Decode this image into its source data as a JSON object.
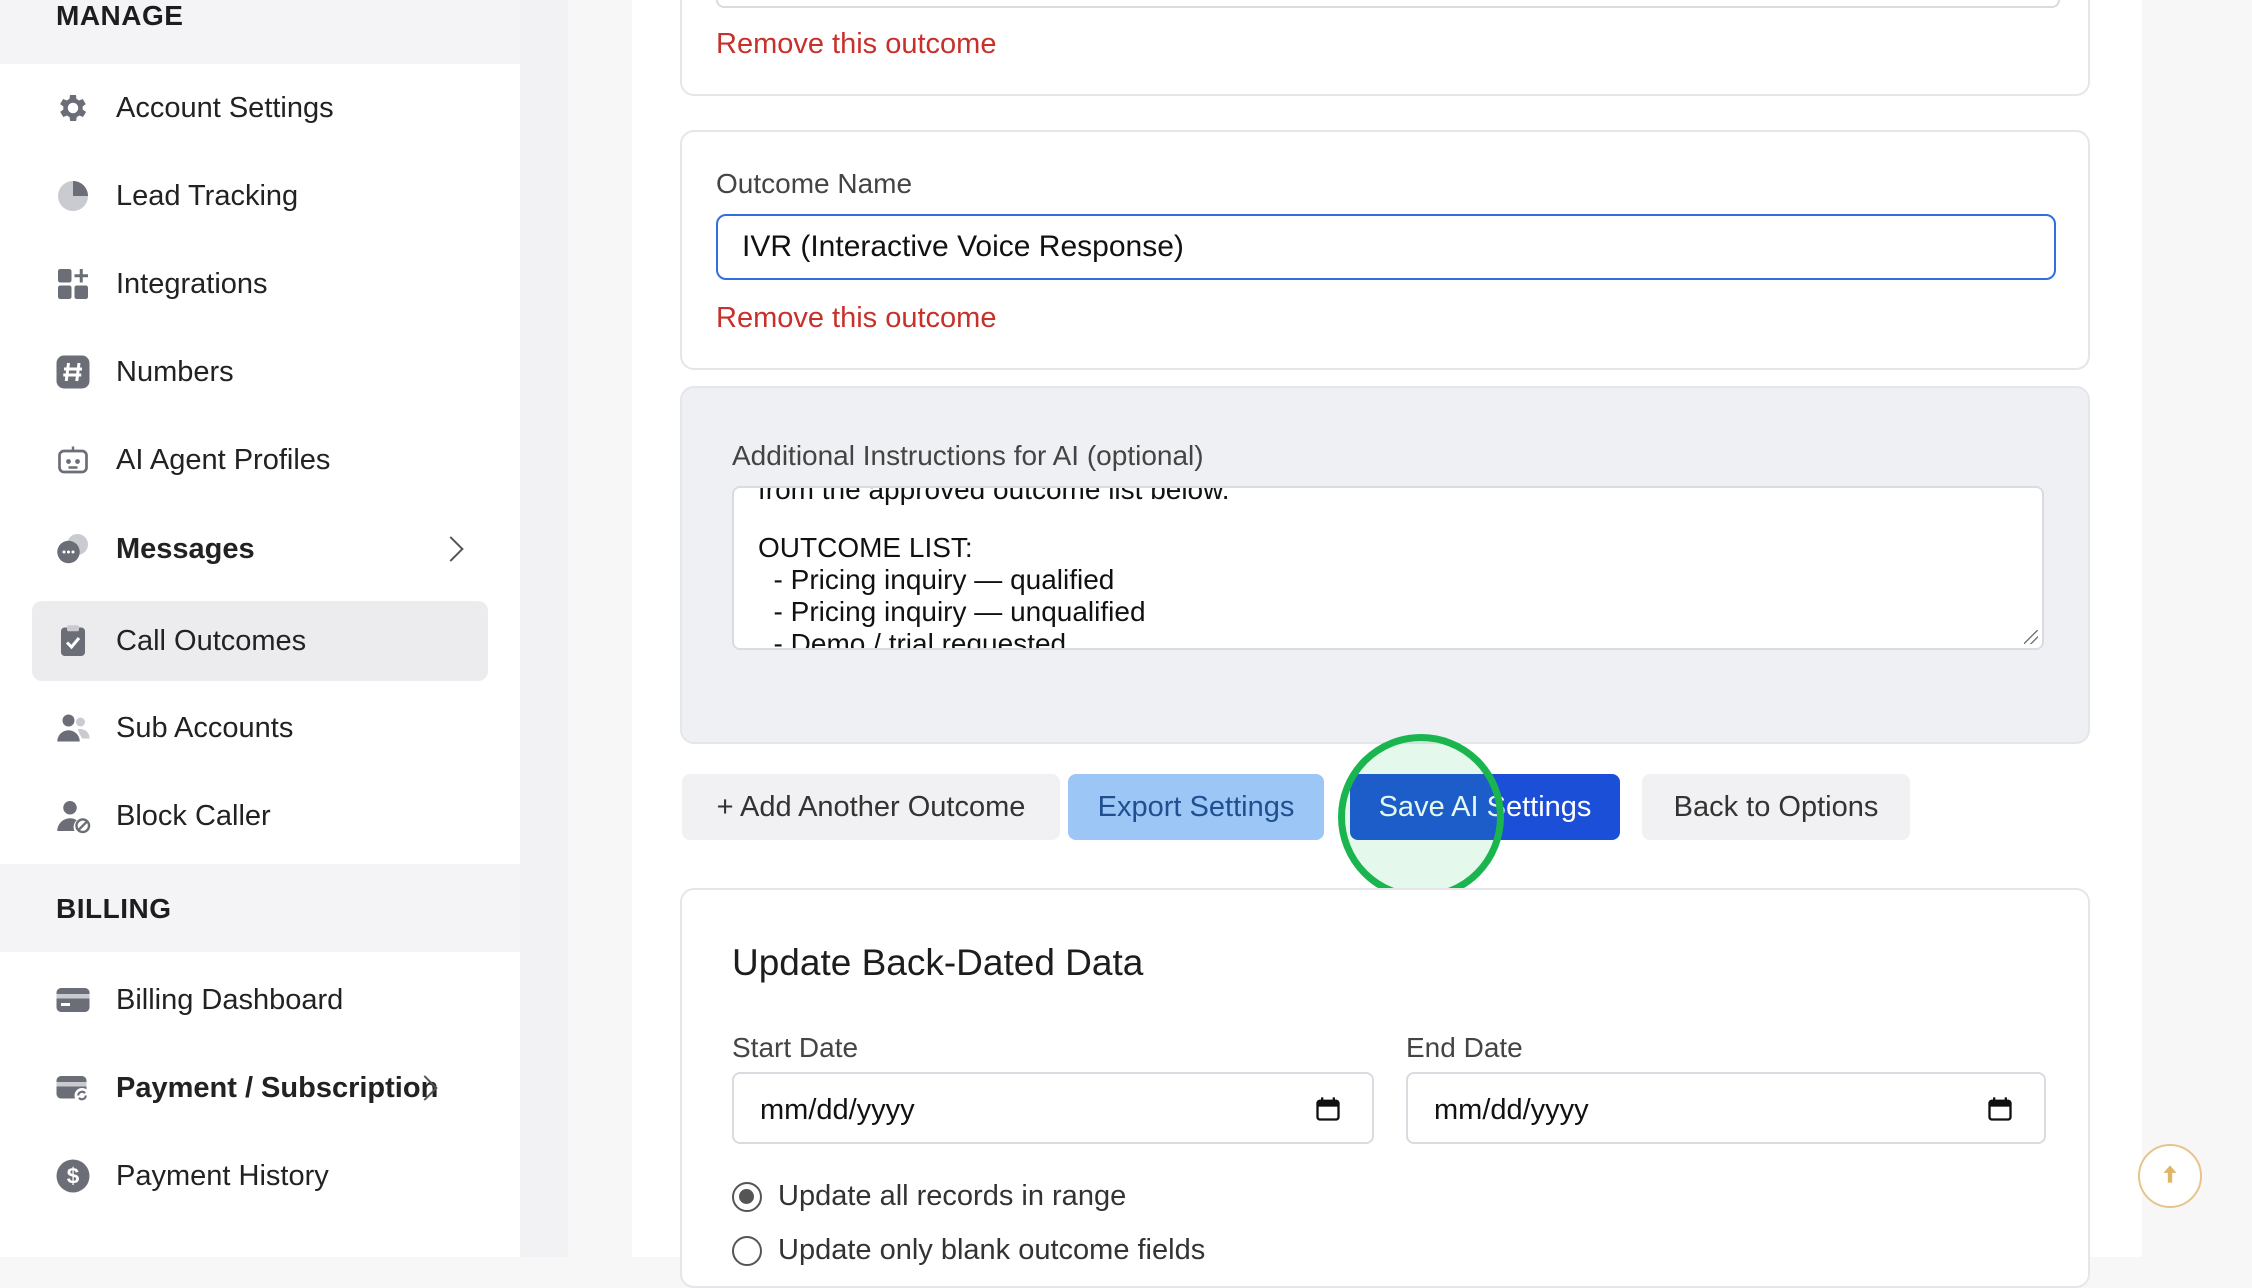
{
  "sidebar": {
    "manage_header": "MANAGE",
    "billing_header": "BILLING",
    "manage_items": [
      {
        "label": "Account Settings",
        "icon": "gear-icon"
      },
      {
        "label": "Lead Tracking",
        "icon": "pie-chart-icon"
      },
      {
        "label": "Integrations",
        "icon": "grid-plus-icon"
      },
      {
        "label": "Numbers",
        "icon": "hashtag-icon"
      },
      {
        "label": "AI Agent Profiles",
        "icon": "robot-icon"
      },
      {
        "label": "Messages",
        "icon": "chat-bubbles-icon"
      },
      {
        "label": "Call Outcomes",
        "icon": "clipboard-check-icon"
      },
      {
        "label": "Sub Accounts",
        "icon": "users-icon"
      },
      {
        "label": "Block Caller",
        "icon": "user-block-icon"
      }
    ],
    "billing_items": [
      {
        "label": "Billing Dashboard",
        "icon": "credit-card-icon"
      },
      {
        "label": "Payment / Subscription",
        "icon": "card-refresh-icon"
      },
      {
        "label": "Payment History",
        "icon": "dollar-circle-icon"
      }
    ]
  },
  "outcomes": {
    "remove_label": "Remove this outcome",
    "field_label": "Outcome Name",
    "current_value": "IVR (Interactive Voice Response)"
  },
  "ai": {
    "label": "Additional Instructions for AI (optional)",
    "lines": [
      "from the approved outcome list below.",
      "",
      "OUTCOME LIST:",
      "  - Pricing inquiry — qualified",
      "  - Pricing inquiry — unqualified",
      "  - Demo / trial requested"
    ]
  },
  "actions": {
    "add_outcome": "+ Add Another Outcome",
    "export": "Export Settings",
    "save": "Save AI Settings",
    "back": "Back to Options"
  },
  "backdated": {
    "title": "Update Back-Dated Data",
    "start_label": "Start Date",
    "end_label": "End Date",
    "date_placeholder": "mm/dd/yyyy",
    "radio_all": "Update all records in range",
    "radio_blank": "Update only blank outcome fields"
  },
  "colors": {
    "accent": "#1b4fd8",
    "danger": "#c7302b",
    "click_marker": "#1bb54f"
  }
}
